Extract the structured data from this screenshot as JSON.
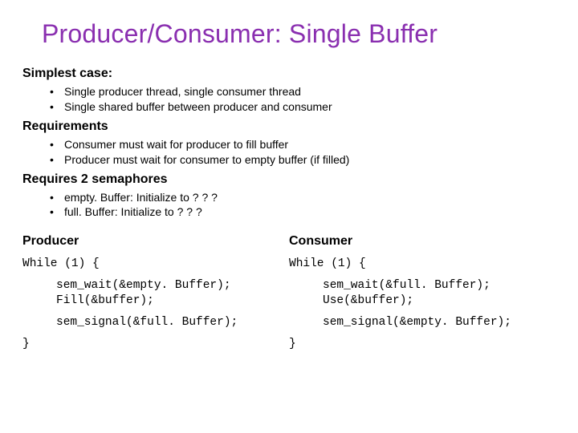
{
  "title": "Producer/Consumer: Single Buffer",
  "sections": {
    "simplest": {
      "head": "Simplest case:",
      "items": [
        "Single producer thread, single consumer thread",
        "Single shared buffer between producer and consumer"
      ]
    },
    "requirements": {
      "head": "Requirements",
      "items": [
        "Consumer must wait for producer to fill buffer",
        "Producer must wait for consumer to empty buffer (if filled)"
      ]
    },
    "semaphores": {
      "head": "Requires 2 semaphores",
      "items": [
        "empty. Buffer: Initialize to ? ? ?",
        "full. Buffer: Initialize to ? ? ?"
      ]
    }
  },
  "producer": {
    "head": "Producer",
    "while": "While (1) {",
    "l1": "sem_wait(&empty. Buffer);",
    "l2": "Fill(&buffer);",
    "l3": "sem_signal(&full. Buffer);",
    "close": "}"
  },
  "consumer": {
    "head": "Consumer",
    "while": "While (1) {",
    "l1": "sem_wait(&full. Buffer);",
    "l2": "Use(&buffer);",
    "l3": "sem_signal(&empty. Buffer);",
    "close": "}"
  }
}
